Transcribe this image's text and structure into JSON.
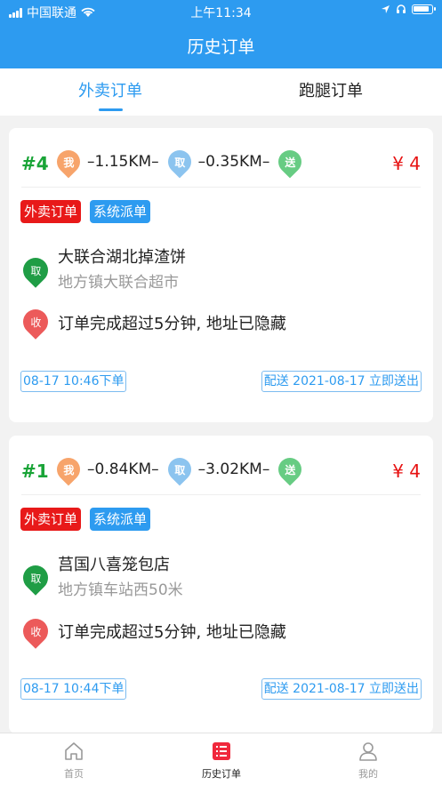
{
  "status_bar": {
    "carrier": "中国联通",
    "time": "上午11:34"
  },
  "header": {
    "title": "历史订单"
  },
  "tabs": [
    {
      "label": "外卖订单",
      "active": true
    },
    {
      "label": "跑腿订单",
      "active": false
    }
  ],
  "orders": [
    {
      "number": "#4",
      "me_label": "我",
      "dist1": "–1.15KM–",
      "pick_label": "取",
      "dist2": "–0.35KM–",
      "deliver_label": "送",
      "price": "¥ 4",
      "tag1": "外卖订单",
      "tag2": "系统派单",
      "shop_name": "大联合湖北掉渣饼",
      "shop_addr": "地方镇大联合超市",
      "pick_icon": "取",
      "drop_icon": "收",
      "recipient_note": "订单完成超过5分钟, 地址已隐藏",
      "order_time": "08-17 10:46下单",
      "delivery_info": "配送  2021-08-17  立即送出"
    },
    {
      "number": "#1",
      "me_label": "我",
      "dist1": "–0.84KM–",
      "pick_label": "取",
      "dist2": "–3.02KM–",
      "deliver_label": "送",
      "price": "¥ 4",
      "tag1": "外卖订单",
      "tag2": "系统派单",
      "shop_name": "莒国八喜笼包店",
      "shop_addr": "地方镇车站西50米",
      "pick_icon": "取",
      "drop_icon": "收",
      "recipient_note": "订单完成超过5分钟, 地址已隐藏",
      "order_time": "08-17 10:44下单",
      "delivery_info": "配送  2021-08-17  立即送出"
    }
  ],
  "bottom_nav": [
    {
      "label": "首页",
      "icon": "home-icon"
    },
    {
      "label": "历史订单",
      "icon": "history-orders-icon",
      "active": true
    },
    {
      "label": "我的",
      "icon": "profile-icon"
    }
  ],
  "colors": {
    "primary": "#2d9bf0",
    "price_red": "#e71212",
    "order_num_green": "#19a437"
  }
}
